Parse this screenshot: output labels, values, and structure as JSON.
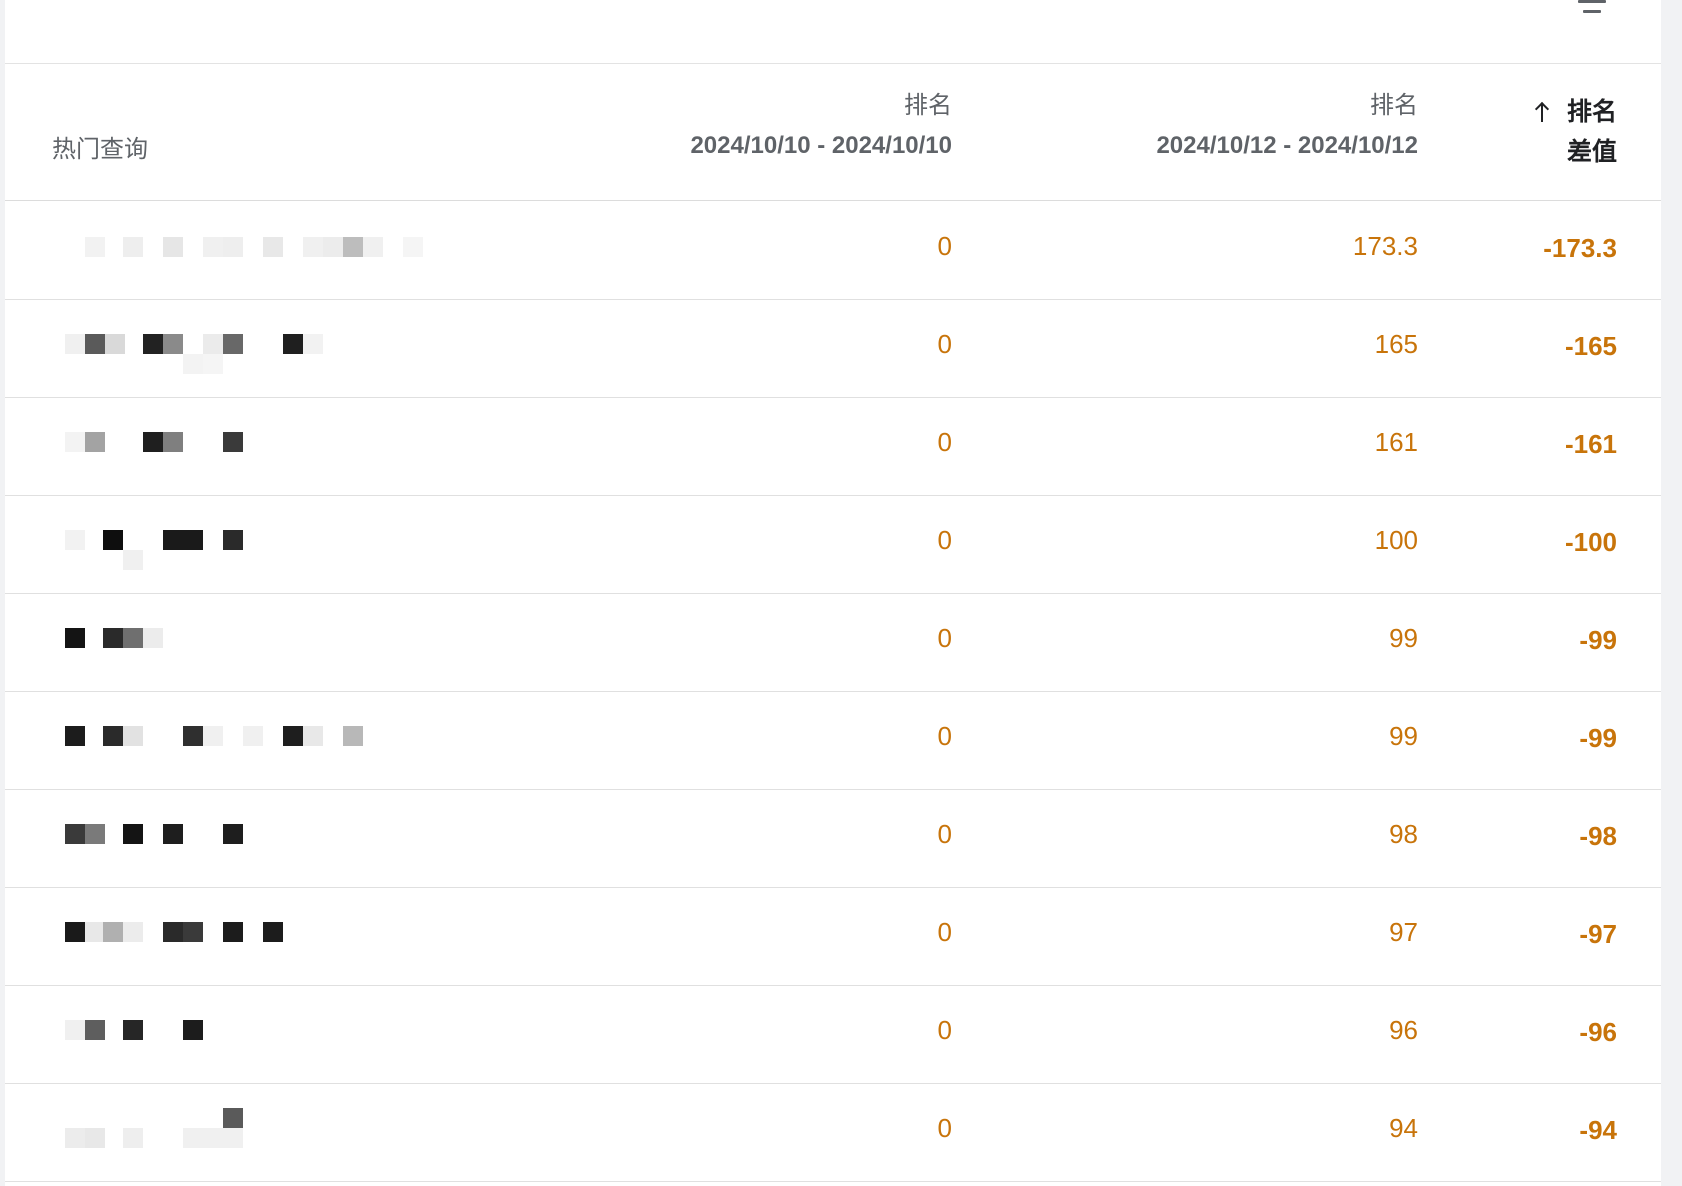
{
  "colors": {
    "accent_orange": "#c8740a",
    "header_text": "#5f6368",
    "active_header": "#202124"
  },
  "toolbar": {
    "filter_icon": "filter-list-icon"
  },
  "table": {
    "headers": {
      "query": "热门查询",
      "rank1_title": "排名",
      "rank1_dates": "2024/10/10 - 2024/10/10",
      "rank2_title": "排名",
      "rank2_dates": "2024/10/12 - 2024/10/12",
      "diff_title": "排名",
      "diff_sub": "差值",
      "sort_icon": "arrow-upward-icon"
    },
    "rows": [
      {
        "rank1": "0",
        "rank2": "173.3",
        "diff": "-173.3"
      },
      {
        "rank1": "0",
        "rank2": "165",
        "diff": "-165"
      },
      {
        "rank1": "0",
        "rank2": "161",
        "diff": "-161"
      },
      {
        "rank1": "0",
        "rank2": "100",
        "diff": "-100"
      },
      {
        "rank1": "0",
        "rank2": "99",
        "diff": "-99"
      },
      {
        "rank1": "0",
        "rank2": "99",
        "diff": "-99"
      },
      {
        "rank1": "0",
        "rank2": "98",
        "diff": "-98"
      },
      {
        "rank1": "0",
        "rank2": "97",
        "diff": "-97"
      },
      {
        "rank1": "0",
        "rank2": "96",
        "diff": "-96"
      },
      {
        "rank1": "0",
        "rank2": "94",
        "diff": "-94"
      }
    ]
  }
}
